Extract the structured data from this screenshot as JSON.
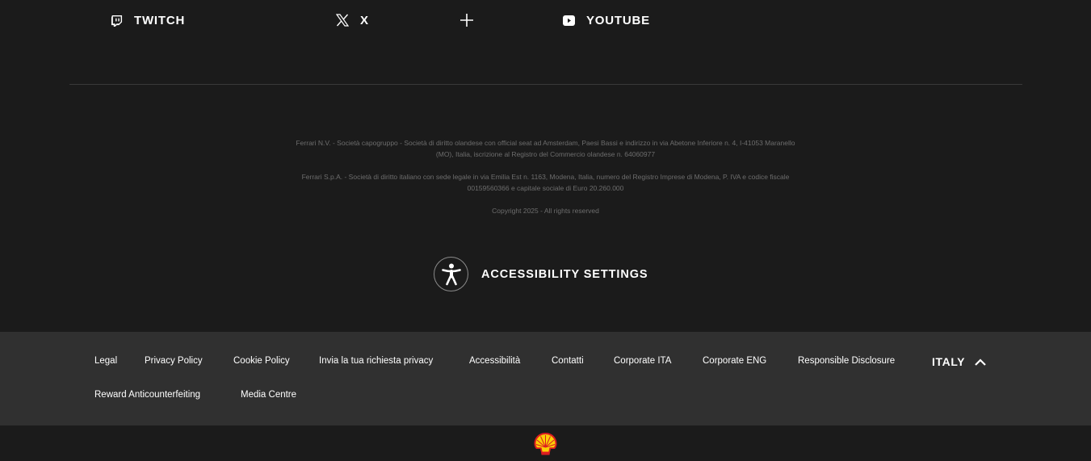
{
  "social": {
    "twitch": "TWITCH",
    "x": "X",
    "youtube": "YOUTUBE"
  },
  "legal": {
    "nv": "Ferrari N.V. - Società capogruppo - Società di diritto olandese con official seat ad Amsterdam, Paesi Bassi e indirizzo in via Abetone Inferiore n. 4, I-41053 Maranello (MO), Italia, iscrizione al Registro del Commercio olandese n. 64060977",
    "spa": "Ferrari S.p.A. - Società di diritto italiano con sede legale in via Emilia Est n. 1163, Modena, Italia, numero del Registro Imprese di Modena, P. IVA e codice fiscale 00159560366 e capitale sociale di Euro 20.260.000",
    "copyright": "Copyright 2025 - All rights reserved"
  },
  "accessibility": {
    "label": "ACCESSIBILITY SETTINGS"
  },
  "footer_links": {
    "legal": "Legal",
    "privacy": "Privacy Policy",
    "cookie": "Cookie Policy",
    "privacy_request": "Invia la tua richiesta privacy",
    "accessibilita": "Accessibilità",
    "contatti": "Contatti",
    "corporate_ita": "Corporate ITA",
    "corporate_eng": "Corporate ENG",
    "responsible": "Responsible Disclosure",
    "reward": "Reward Anticounterfeiting",
    "media": "Media Centre"
  },
  "country": {
    "label": "ITALY"
  },
  "icons": {
    "twitch": "twitch-icon",
    "x": "x-icon",
    "plus": "plus-icon",
    "youtube": "youtube-icon",
    "accessibility": "accessibility-person-icon",
    "chevron": "chevron-up-icon",
    "sponsor": "shell-logo"
  },
  "colors": {
    "background": "#1b1b1b",
    "links_bar": "#303030",
    "legal_text": "#6d6d6d",
    "shell_red": "#dd1d21",
    "shell_yellow": "#fbce07"
  }
}
